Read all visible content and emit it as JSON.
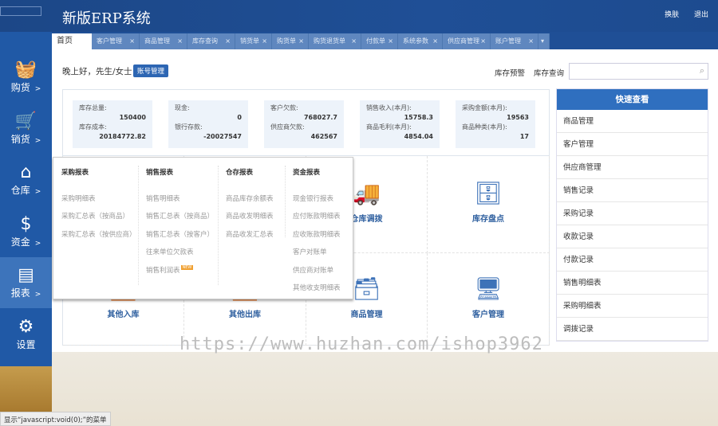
{
  "header": {
    "title": "新版ERP系统",
    "links": [
      "换肤",
      "退出"
    ]
  },
  "sidebar": {
    "items": [
      {
        "label": "购货",
        "icon": "basket-icon",
        "glyph": "🧺"
      },
      {
        "label": "销货",
        "icon": "cart-icon",
        "glyph": "🛒"
      },
      {
        "label": "仓库",
        "icon": "warehouse-icon",
        "glyph": "⌂"
      },
      {
        "label": "资金",
        "icon": "dollar-icon",
        "glyph": "$"
      },
      {
        "label": "报表",
        "icon": "report-icon",
        "glyph": "▤"
      },
      {
        "label": "设置",
        "icon": "gear-icon",
        "glyph": "⚙"
      }
    ],
    "arrow": ">",
    "active": "报表"
  },
  "tabs": [
    "首页",
    "客户管理",
    "商品管理",
    "库存查询",
    "销货单",
    "购货单",
    "购货退货单",
    "付款单",
    "系统参数",
    "供应商管理",
    "账户管理"
  ],
  "tab_close": "×",
  "tab_more": "▾",
  "greeting": "晚上好，先生/女士",
  "account_button": "账号管理",
  "stock_links": [
    "库存预警",
    "库存查询"
  ],
  "search": {
    "value": "",
    "placeholder": ""
  },
  "stats": [
    {
      "l1": "库存总量:",
      "v1": "150400",
      "l2": "库存成本:",
      "v2": "20184772.82"
    },
    {
      "l1": "现金:",
      "v1": "0",
      "l2": "银行存款:",
      "v2": "-20027547"
    },
    {
      "l1": "客户欠款:",
      "v1": "768027.7",
      "l2": "供应商欠款:",
      "v2": "462567"
    },
    {
      "l1": "销售收入(本月):",
      "v1": "15758.3",
      "l2": "商品毛利(本月):",
      "v2": "4854.04"
    },
    {
      "l1": "采购金额(本月):",
      "v1": "19563",
      "l2": "商品种类(本月):",
      "v2": "17"
    }
  ],
  "tiles": [
    {
      "label": "仓库调拨",
      "icon": "truck-icon",
      "glyph": "🚚"
    },
    {
      "label": "库存盘点",
      "icon": "inventory-check-icon",
      "glyph": "🗄"
    },
    {
      "label": "其他入库",
      "icon": "stock-in-icon",
      "glyph": "📥"
    },
    {
      "label": "其他出库",
      "icon": "stock-out-icon",
      "glyph": "📤"
    },
    {
      "label": "商品管理",
      "icon": "product-box-icon",
      "glyph": "🗃"
    },
    {
      "label": "客户管理",
      "icon": "monitor-user-icon",
      "glyph": "🖥"
    }
  ],
  "quick": {
    "title": "快速查看",
    "items": [
      "商品管理",
      "客户管理",
      "供应商管理",
      "销售记录",
      "采购记录",
      "收款记录",
      "付款记录",
      "销售明细表",
      "采购明细表",
      "调拨记录"
    ]
  },
  "report_menu": [
    {
      "title": "采购报表",
      "items": [
        "采购明细表",
        "采购汇总表（按商品）",
        "采购汇总表（按供应商）"
      ]
    },
    {
      "title": "销售报表",
      "items": [
        "销售明细表",
        "销售汇总表（按商品）",
        "销售汇总表（按客户）",
        "往来单位欠款表",
        "销售利润表"
      ]
    },
    {
      "title": "仓存报表",
      "items": [
        "商品库存余额表",
        "商品收发明细表",
        "商品收发汇总表"
      ]
    },
    {
      "title": "资金报表",
      "items": [
        "现金银行报表",
        "应付账款明细表",
        "应收账款明细表",
        "客户对账单",
        "供应商对账单",
        "其他收支明细表"
      ]
    }
  ],
  "new_badge": "NEW",
  "watermark": "https://www.huzhan.com/ishop3962",
  "status_bar": "显示“javascript:void(0);”的菜单",
  "colors": {
    "header": "#1d4b8f",
    "sidebar": "#2059a6",
    "accent": "#2f6fbf",
    "card_bg": "#edf3fa"
  }
}
